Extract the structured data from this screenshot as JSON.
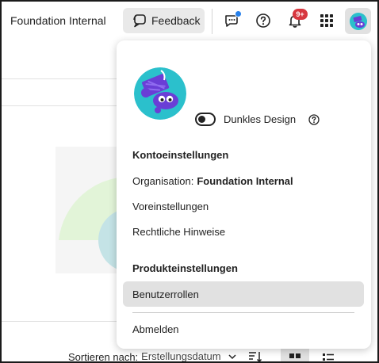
{
  "topbar": {
    "org_name": "Foundation Internal",
    "feedback_label": "Feedback",
    "notification_badge": "9+"
  },
  "sort": {
    "label": "Sortieren nach:",
    "value": "Erstellungsdatum"
  },
  "menu": {
    "dark_mode_label": "Dunkles Design",
    "dark_mode_on": false,
    "account_section": "Kontoeinstellungen",
    "organisation_label": "Organisation:",
    "organisation_value": "Foundation Internal",
    "preferences": "Voreinstellungen",
    "legal": "Rechtliche Hinweise",
    "product_section": "Produkteinstellungen",
    "user_roles": "Benutzerrollen",
    "sign_out": "Abmelden"
  },
  "colors": {
    "badge": "#d7373f",
    "chat_dot": "#2680eb",
    "avatar_bg": "#2bc0cc",
    "avatar_purple": "#6a3ed6"
  }
}
